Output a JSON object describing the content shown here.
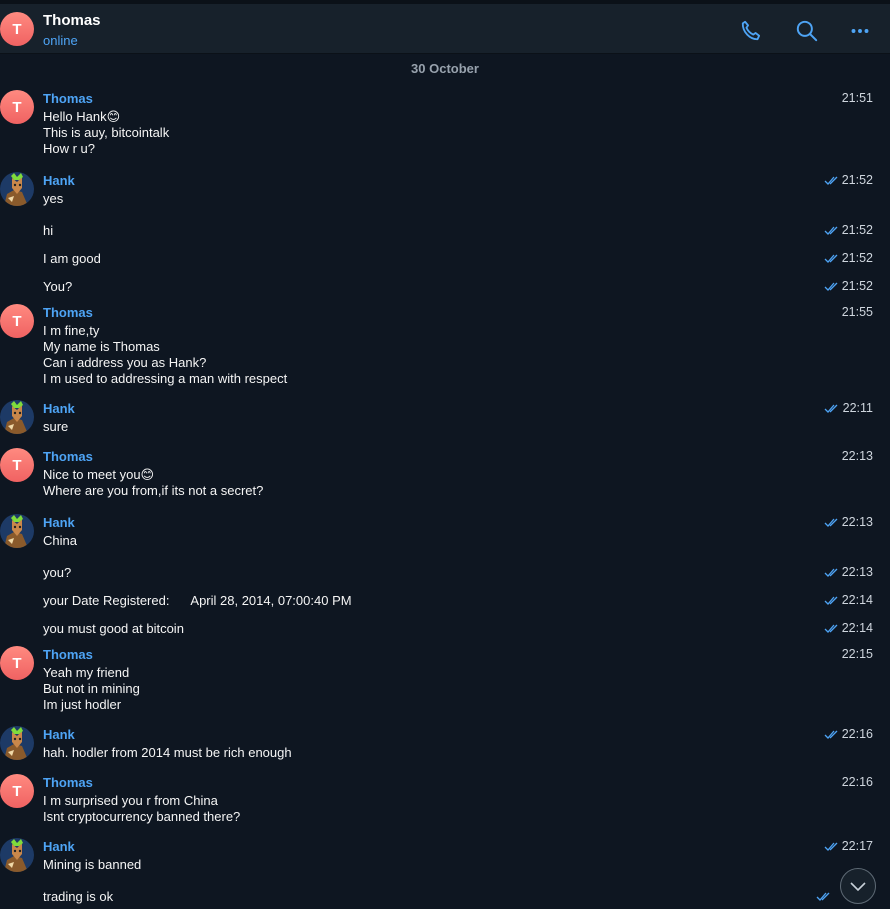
{
  "header": {
    "title": "Thomas",
    "status": "online",
    "avatar_letter": "T",
    "icons": [
      "phone-icon",
      "search-icon",
      "more-icon"
    ]
  },
  "date_separator": "30 October",
  "messages": [
    {
      "sender": "Thomas",
      "time": "21:51",
      "lines": [
        "Hello Hank😊",
        "This is auy, bitcointalk",
        "How r u?"
      ]
    },
    {
      "sender": "Hank",
      "time": "21:52",
      "lines": [
        "yes"
      ],
      "read": true
    },
    {
      "sender": "",
      "time": "21:52",
      "lines": [
        "hi"
      ],
      "read": true
    },
    {
      "sender": "",
      "time": "21:52",
      "lines": [
        "I am good"
      ],
      "read": true
    },
    {
      "sender": "",
      "time": "21:52",
      "lines": [
        "You?"
      ],
      "read": true
    },
    {
      "sender": "Thomas",
      "time": "21:55",
      "lines": [
        "I m fine,ty",
        "My name is Thomas",
        "Can i address you as Hank?",
        "I m used to addressing a man with respect"
      ]
    },
    {
      "sender": "Hank",
      "time": "22:11",
      "lines": [
        "sure"
      ],
      "read": true
    },
    {
      "sender": "Thomas",
      "time": "22:13",
      "lines": [
        "Nice to meet you😊",
        "Where are you from,if its not a secret?"
      ]
    },
    {
      "sender": "Hank",
      "time": "22:13",
      "lines": [
        "China"
      ],
      "read": true
    },
    {
      "sender": "",
      "time": "22:13",
      "lines": [
        "you?"
      ],
      "read": true
    },
    {
      "sender": "",
      "time": "22:14",
      "lines": [
        "your Date Registered:      April 28, 2014, 07:00:40 PM"
      ],
      "read": true
    },
    {
      "sender": "",
      "time": "22:14",
      "lines": [
        "you must good at bitcoin"
      ],
      "read": true
    },
    {
      "sender": "Thomas",
      "time": "22:15",
      "lines": [
        "Yeah my friend",
        "But not in mining",
        "Im just hodler"
      ]
    },
    {
      "sender": "Hank",
      "time": "22:16",
      "lines": [
        "hah. hodler from 2014 must be rich enough"
      ],
      "read": true
    },
    {
      "sender": "Thomas",
      "time": "22:16",
      "lines": [
        "I m surprised you r from China",
        "Isnt cryptocurrency banned there?"
      ]
    },
    {
      "sender": "Hank",
      "time": "22:17",
      "lines": [
        "Mining is banned"
      ],
      "read": true
    },
    {
      "sender": "",
      "time": "",
      "lines": [
        "trading is ok"
      ],
      "read": true
    }
  ],
  "colors": {
    "background": "#0e1621",
    "header": "#17212b",
    "accent": "#4ea4f5",
    "avatar": "#f06262"
  }
}
